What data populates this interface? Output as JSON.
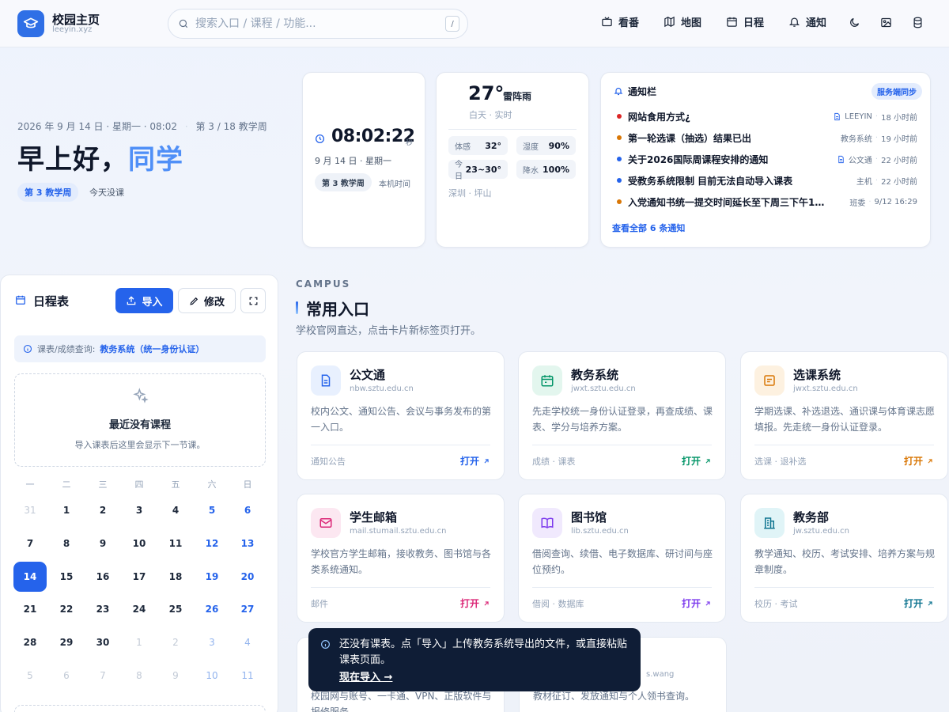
{
  "header": {
    "brand_title": "校园主页",
    "brand_sub": "leeyin.xyz",
    "search_placeholder": "搜索入口 / 课程 / 功能...",
    "search_shortcut": "/",
    "nav": [
      {
        "label": "看番",
        "icon": "tv-icon"
      },
      {
        "label": "地图",
        "icon": "map-icon"
      },
      {
        "label": "日程",
        "icon": "calendar-icon"
      },
      {
        "label": "通知",
        "icon": "bell-icon"
      }
    ],
    "icon_buttons": [
      "moon-icon",
      "image-icon",
      "database-icon"
    ]
  },
  "hero": {
    "date_line": "2026 年 9 月 14 日 · 星期一 · 08:02",
    "week_line": "第 3 / 18 教学周",
    "greeting_prefix": "早上好，",
    "greeting_name": "同学",
    "week_badge": "第 3 教学周",
    "class_status": "今天没课"
  },
  "clock": {
    "time": "08:02:22",
    "seconds_label": "秒",
    "date": "9 月 14 日 · 星期一",
    "week_badge": "第 3 教学周",
    "time_source": "本机时间"
  },
  "weather": {
    "temp": "27°",
    "condition": "雷阵雨",
    "sub": "白天 · 实时",
    "stats": [
      {
        "label": "体感",
        "value": "32°"
      },
      {
        "label": "湿度",
        "value": "90%"
      },
      {
        "label": "今日",
        "value": "23~30°"
      },
      {
        "label": "降水",
        "value": "100%"
      }
    ],
    "location": "深圳 · 坪山"
  },
  "notices": {
    "title": "通知栏",
    "sync_badge": "服务端同步",
    "items": [
      {
        "title": "网站食用方式¿",
        "source": "LEEYIN",
        "time": "18 小时前",
        "dot": "#dc2626",
        "doc": true
      },
      {
        "title": "第一轮选课（抽选）结果已出",
        "source": "教务系统",
        "time": "19 小时前",
        "dot": "#d97706",
        "doc": false
      },
      {
        "title": "关于2026国际周课程安排的通知",
        "source": "公文通",
        "time": "22 小时前",
        "dot": "#2563eb",
        "doc": true
      },
      {
        "title": "受教务系统限制 目前无法自动导入课表",
        "source": "主机",
        "time": "22 小时前",
        "dot": "#2563eb",
        "doc": false
      },
      {
        "title": "入党通知书统一提交时间延长至下周三下午1…",
        "source": "班委",
        "time": "9/12 16:29",
        "dot": "#d97706",
        "doc": false
      }
    ],
    "view_all": "查看全部 6 条通知"
  },
  "schedule": {
    "title": "日程表",
    "import_label": "导入",
    "edit_label": "修改",
    "query_label": "课表/成绩查询:",
    "query_link": "教务系统（统一身份认证）",
    "empty_title": "最近没有课程",
    "empty_sub": "导入课表后这里会显示下一节课。",
    "weekdays": [
      "一",
      "二",
      "三",
      "四",
      "五",
      "六",
      "日"
    ],
    "days": [
      "31",
      "1",
      "2",
      "3",
      "4",
      "5",
      "6",
      "7",
      "8",
      "9",
      "10",
      "11",
      "12",
      "13",
      "14",
      "15",
      "16",
      "17",
      "18",
      "19",
      "20",
      "21",
      "22",
      "23",
      "24",
      "25",
      "26",
      "27",
      "28",
      "29",
      "30",
      "1",
      "2",
      "3",
      "4",
      "5",
      "6",
      "7",
      "8",
      "9",
      "10",
      "11"
    ],
    "today_index": 14,
    "current_month_range": [
      1,
      30
    ]
  },
  "campus": {
    "kicker": "CAMPUS",
    "title": "常用入口",
    "subtitle": "学校官网直达，点击卡片新标签页打开。",
    "open_label": "打开",
    "portals": [
      {
        "name": "公文通",
        "url": "nbw.sztu.edu.cn",
        "desc": "校内公文、通知公告、会议与事务发布的第一入口。",
        "tag": "通知公告",
        "icon": "document-icon",
        "color": "#2563eb",
        "bg": "#e8f0fe"
      },
      {
        "name": "教务系统",
        "url": "jwxt.sztu.edu.cn",
        "desc": "先走学校统一身份认证登录，再查成绩、课表、学分与培养方案。",
        "tag": "成绩 · 课表",
        "icon": "calendar-grid-icon",
        "color": "#059669",
        "bg": "#e3f6ee"
      },
      {
        "name": "选课系统",
        "url": "jwxt.sztu.edu.cn",
        "desc": "学期选课、补选退选、通识课与体育课志愿填报。先走统一身份认证登录。",
        "tag": "选课 · 退补选",
        "icon": "list-icon",
        "color": "#d97706",
        "bg": "#fdf1e0"
      },
      {
        "name": "学生邮箱",
        "url": "mail.stumail.sztu.edu.cn",
        "desc": "学校官方学生邮箱，接收教务、图书馆与各类系统通知。",
        "tag": "邮件",
        "icon": "mail-icon",
        "color": "#db2777",
        "bg": "#fce7f1"
      },
      {
        "name": "图书馆",
        "url": "lib.sztu.edu.cn",
        "desc": "借阅查询、续借、电子数据库、研讨间与座位预约。",
        "tag": "借阅 · 数据库",
        "icon": "book-icon",
        "color": "#7c3aed",
        "bg": "#f0e9fd"
      },
      {
        "name": "教务部",
        "url": "jw.sztu.edu.cn",
        "desc": "教学通知、校历、考试安排、培养方案与规章制度。",
        "tag": "校历 · 考试",
        "icon": "building-icon",
        "color": "#0e7490",
        "bg": "#e0f4f7"
      }
    ],
    "partial": [
      {
        "desc": "校园网与账号、一卡通、VPN、正版软件与报修服务。"
      },
      {
        "url_tail": "s.wang",
        "desc": "教材征订、发放通知与个人领书查询。"
      }
    ]
  },
  "toast": {
    "message": "还没有课表。点「导入」上传教务系统导出的文件，或直接粘贴课表页面。",
    "action": "现在导入 →"
  }
}
